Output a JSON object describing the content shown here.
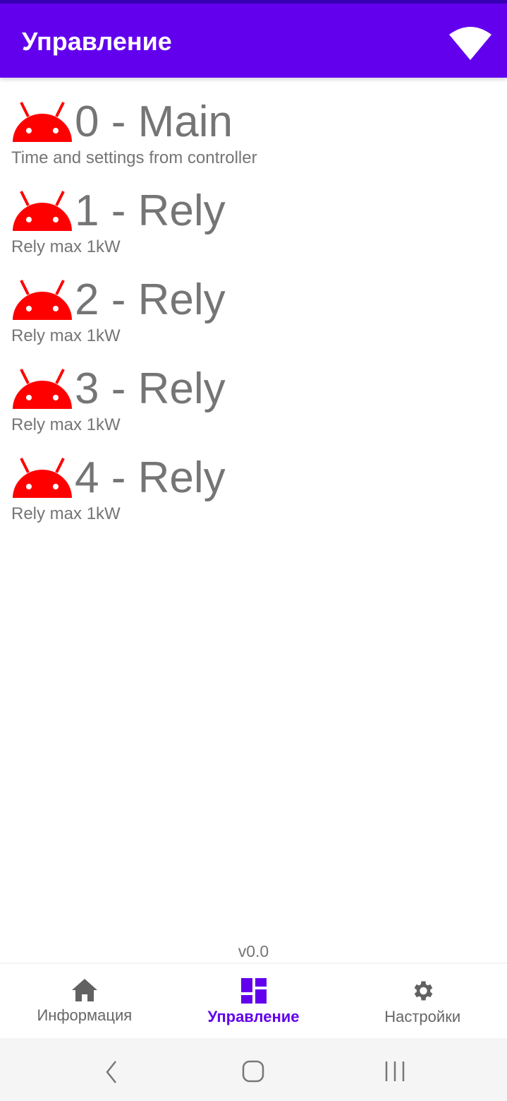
{
  "appbar": {
    "title": "Управление",
    "wifi_icon": "wifi-icon"
  },
  "items": [
    {
      "title": "0 - Main",
      "description": "Time and settings from controller"
    },
    {
      "title": "1 - Rely",
      "description": "Rely max 1kW"
    },
    {
      "title": "2 - Rely",
      "description": "Rely max 1kW"
    },
    {
      "title": "3 - Rely",
      "description": "Rely max 1kW"
    },
    {
      "title": "4 - Rely",
      "description": "Rely max 1kW"
    }
  ],
  "version": "v0.0",
  "bottom_nav": [
    {
      "label": "Информация",
      "icon": "home-icon"
    },
    {
      "label": "Управление",
      "icon": "dashboard-icon",
      "active": true
    },
    {
      "label": "Настройки",
      "icon": "gear-icon"
    }
  ],
  "colors": {
    "primary": "#6200EE",
    "primary_dark": "#3700B3",
    "icon_red": "#FF0000",
    "text_gray": "#757575"
  }
}
